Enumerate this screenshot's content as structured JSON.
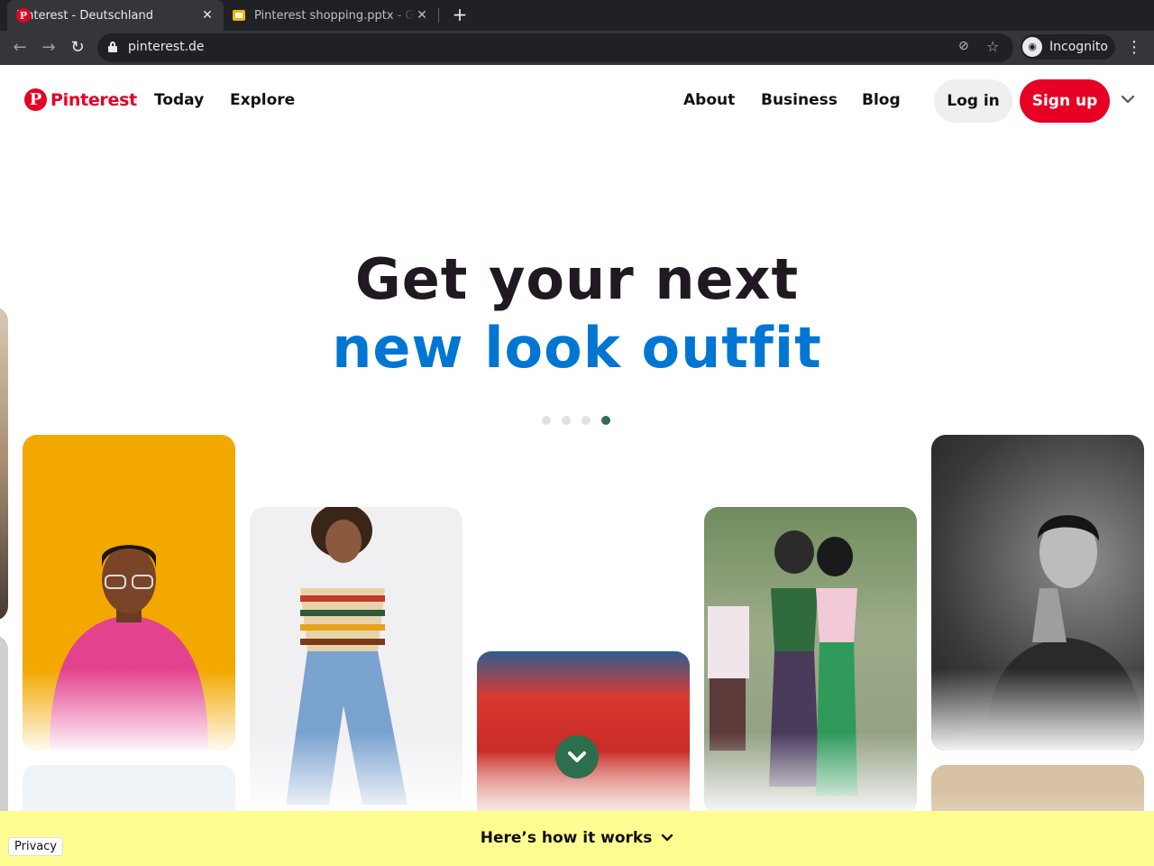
{
  "browser": {
    "tabs": [
      {
        "title": "Pinterest - Deutschland",
        "active": true,
        "favicon": "pinterest-icon"
      },
      {
        "title": "Pinterest shopping.pptx - G",
        "active": false,
        "favicon": "slides-icon"
      }
    ],
    "url": "pinterest.de",
    "profile_label": "Incognito"
  },
  "nav": {
    "logo_text": "Pinterest",
    "left_links": [
      "Today",
      "Explore"
    ],
    "right_links": [
      "About",
      "Business",
      "Blog"
    ],
    "login_label": "Log in",
    "signup_label": "Sign up"
  },
  "hero": {
    "line1": "Get your next",
    "line2": "new look outfit",
    "line2_color": "#0076d3",
    "carousel_total": 4,
    "carousel_active": 4
  },
  "footer_bar": {
    "how_label": "Here’s how it works",
    "privacy_label": "Privacy"
  },
  "colors": {
    "brand": "#e60023",
    "accent_green": "#2d6e4c",
    "banner_yellow": "#fffd92"
  }
}
